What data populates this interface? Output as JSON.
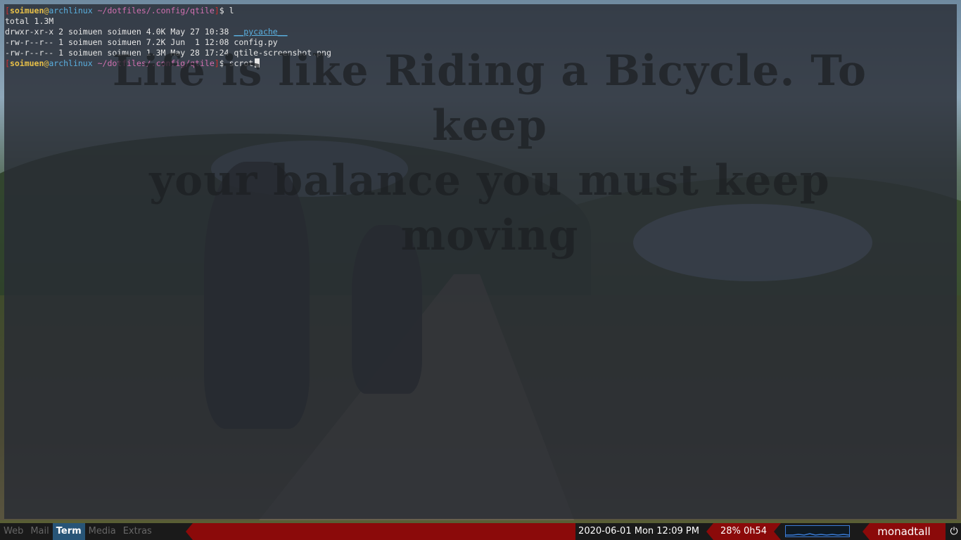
{
  "terminal": {
    "prompt": {
      "user": "soimuen",
      "at": "@",
      "host": "archlinux",
      "path": "~/dotfiles/.config/qtile",
      "dollar": "$"
    },
    "commands": [
      "l",
      "scrot"
    ],
    "output": {
      "total": "total 1.3M",
      "rows": [
        {
          "meta": "drwxr-xr-x 2 soimuen soimuen 4.0K May 27 10:38 ",
          "name": "__pycache__"
        },
        {
          "meta": "-rw-r--r-- 1 soimuen soimuen 7.2K Jun  1 12:08 ",
          "name": "config.py"
        },
        {
          "meta": "-rw-r--r-- 1 soimuen soimuen 1.3M May 28 17:24 ",
          "name": "qtile-screenshot.png"
        }
      ]
    }
  },
  "wallpaper": {
    "quote_line1": "Life is like Riding a Bicycle. To keep",
    "quote_line2": "your balance you must keep moving"
  },
  "bar": {
    "groups": [
      "Web",
      "Mail",
      "Term",
      "Media",
      "Extras"
    ],
    "active_group": "Term",
    "clock": "2020-06-01 Mon 12:09 PM",
    "battery": "28% 0h54",
    "layout": "monadtall",
    "power_icon": "power-icon",
    "colors": {
      "accent": "#8b0a0a",
      "active_group": "#285577",
      "graph_border": "#3a7bd5"
    }
  }
}
